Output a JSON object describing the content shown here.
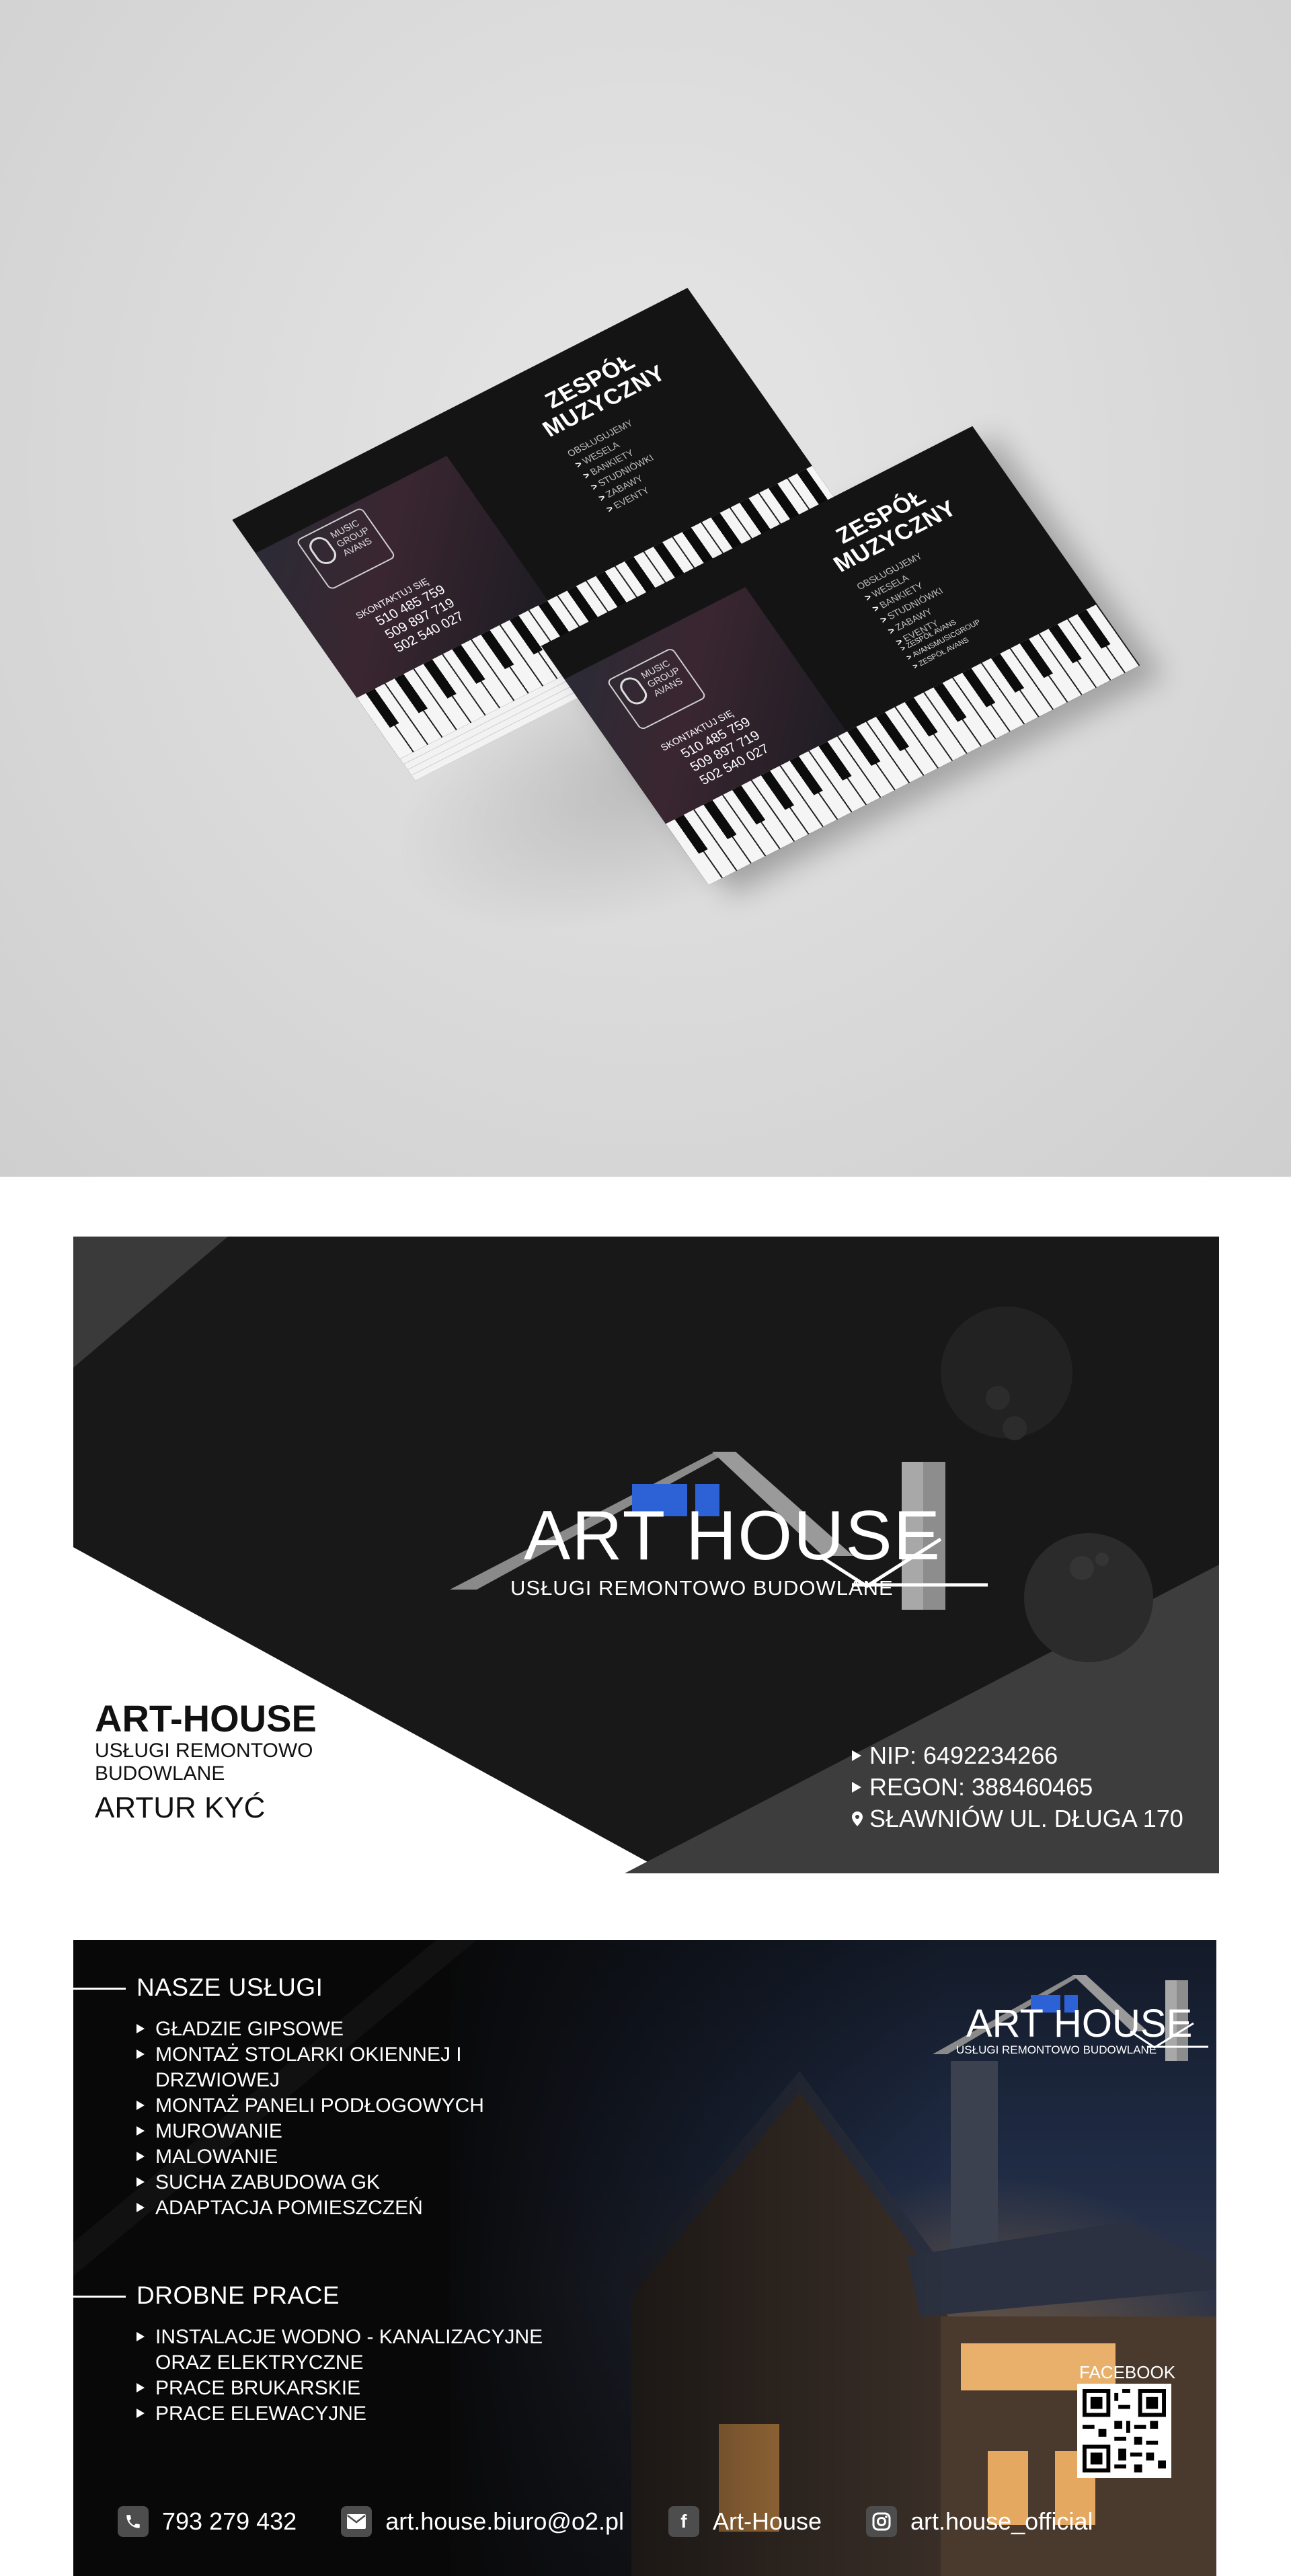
{
  "mockup": {
    "title_line1": "ZESPÓŁ",
    "title_line2": "MUZYCZNY",
    "services_header": "OBSŁUGUJEMY",
    "services": [
      "WESELA",
      "BANKIETY",
      "STUDNIÓWKI",
      "ZABAWY",
      "EVENTY"
    ],
    "social": [
      "ZESPÓŁ AVANS",
      "AVANSMUSICGROUP",
      "ZESPÓŁ AVANS"
    ],
    "logo_line1": "MUSIC",
    "logo_line2": "GROUP",
    "logo_line3": "AVANS",
    "contact_label": "SKONTAKTUJ SIĘ",
    "phones": [
      "510 485 759",
      "509 897 719",
      "502 540 027"
    ]
  },
  "front": {
    "brand": "ART HOUSE",
    "tagline": "USŁUGI REMONTOWO BUDOWLANE",
    "company": "ART-HOUSE",
    "company_services": "USŁUGI REMONTOWO BUDOWLANE",
    "owner": "ARTUR KYĆ",
    "nip": "NIP: 6492234266",
    "regon": "REGON: 388460465",
    "address": "SŁAWNIÓW UL. DŁUGA 170",
    "colors": {
      "background": "#181818",
      "accent_blue": "#2c62d6",
      "gray_panel": "#3d3d3d",
      "white_panel": "#ffffff"
    }
  },
  "back": {
    "section1_title": "NASZE USŁUGI",
    "section1_items": [
      {
        "line1": "GŁADZIE GIPSOWE",
        "line2": ""
      },
      {
        "line1": "MONTAŻ STOLARKI OKIENNEJ I",
        "line2": "DRZWIOWEJ"
      },
      {
        "line1": "MONTAŻ PANELI PODŁOGOWYCH",
        "line2": ""
      },
      {
        "line1": "MUROWANIE",
        "line2": ""
      },
      {
        "line1": "MALOWANIE",
        "line2": ""
      },
      {
        "line1": "SUCHA ZABUDOWA GK",
        "line2": ""
      },
      {
        "line1": "ADAPTACJA POMIESZCZEŃ",
        "line2": ""
      }
    ],
    "section2_title": "DROBNE PRACE",
    "section2_items": [
      {
        "line1": "INSTALACJE WODNO - KANALIZACYJNE",
        "line2": "ORAZ ELEKTRYCZNE"
      },
      {
        "line1": "PRACE BRUKARSKIE",
        "line2": ""
      },
      {
        "line1": "PRACE ELEWACYJNE",
        "line2": ""
      }
    ],
    "logo_brand": "ART HOUSE",
    "logo_tagline": "USŁUGI REMONTOWO BUDOWLANE",
    "qr_label": "FACEBOOK",
    "phone": "793 279 432",
    "email": "art.house.biuro@o2.pl",
    "facebook": "Art-House",
    "instagram": "art.house_official",
    "icons": [
      "phone-icon",
      "envelope-icon",
      "facebook-icon",
      "instagram-icon"
    ]
  }
}
